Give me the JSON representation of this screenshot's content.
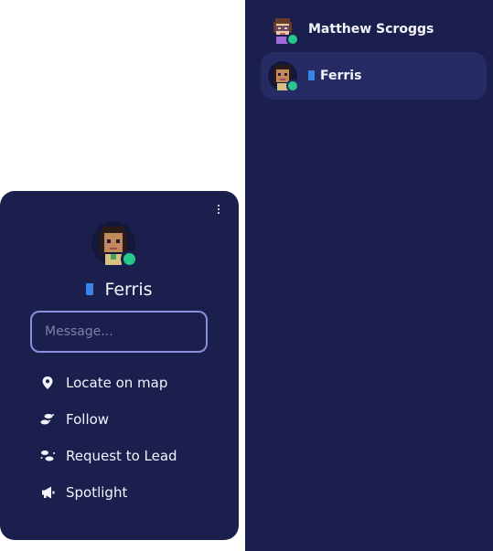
{
  "participants": [
    {
      "name": "Matthew Scroggs",
      "selected": false,
      "status": "online",
      "icon": "avatar-glasses"
    },
    {
      "name": "Ferris",
      "selected": true,
      "status": "online",
      "icon": "avatar-dark-hair",
      "badge": "bookmark-icon"
    }
  ],
  "card": {
    "name": "Ferris",
    "status": "online",
    "message_placeholder": "Message...",
    "menu": [
      {
        "label": "Locate on map",
        "icon": "map-pin-icon"
      },
      {
        "label": "Follow",
        "icon": "follow-icon"
      },
      {
        "label": "Request to Lead",
        "icon": "request-lead-icon"
      },
      {
        "label": "Spotlight",
        "icon": "megaphone-icon"
      }
    ]
  },
  "colors": {
    "panel": "#1a1f4e",
    "selected_row": "#262b64",
    "online": "#27c88a",
    "badge": "#3a86e8",
    "input_border": "#8b8fd9"
  }
}
